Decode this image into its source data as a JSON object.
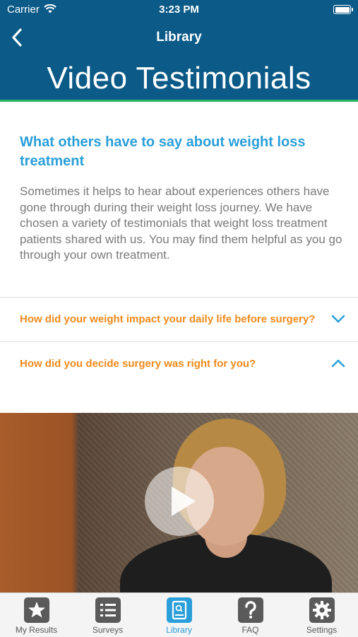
{
  "status_bar": {
    "carrier": "Carrier",
    "time": "3:23 PM"
  },
  "nav": {
    "title": "Library",
    "back_icon": "chevron-left-icon"
  },
  "page": {
    "heading": "Video Testimonials"
  },
  "intro": {
    "title": "What others have to say about weight loss treatment",
    "body": "Sometimes it helps to hear about experiences others have gone through during their weight loss journey. We have chosen a variety of testimonials that weight loss treatment patients shared with us. You may find them helpful as you go through your own treatment."
  },
  "faq": [
    {
      "question": "How did your weight impact your daily life before surgery?",
      "state": "collapsed"
    },
    {
      "question": "How did you decide surgery was right for you?",
      "state": "expanded"
    }
  ],
  "colors": {
    "header_bg": "#0b5a87",
    "accent_blue": "#2a9fd9",
    "accent_orange": "#ef8a1b",
    "header_border": "#2fb36a"
  },
  "tabs": [
    {
      "label": "My Results",
      "icon": "star-icon"
    },
    {
      "label": "Surveys",
      "icon": "list-icon"
    },
    {
      "label": "Library",
      "icon": "book-icon",
      "active": true
    },
    {
      "label": "FAQ",
      "icon": "question-icon"
    },
    {
      "label": "Settings",
      "icon": "gear-icon"
    }
  ]
}
